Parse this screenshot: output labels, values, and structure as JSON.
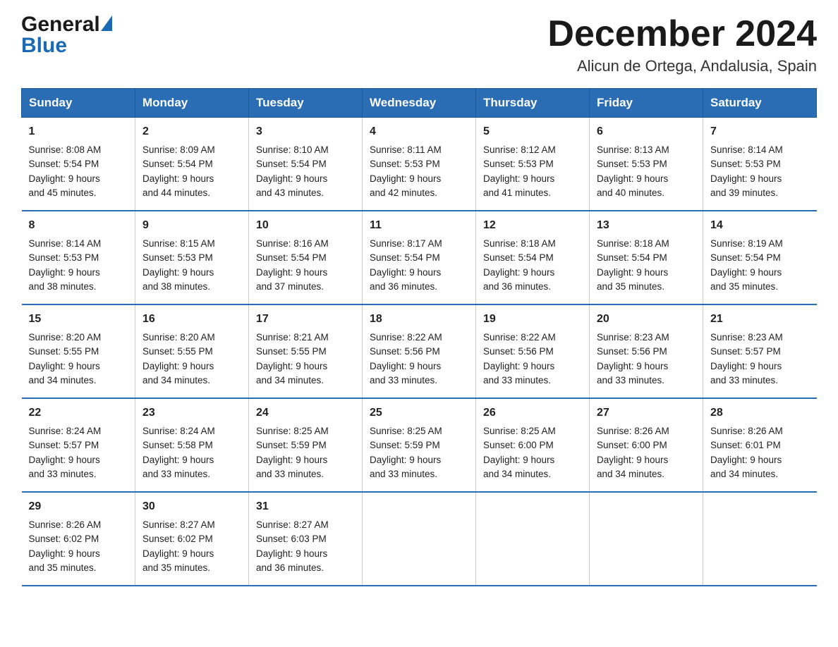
{
  "header": {
    "logo_general": "General",
    "logo_blue": "Blue",
    "title": "December 2024",
    "subtitle": "Alicun de Ortega, Andalusia, Spain"
  },
  "days_of_week": [
    "Sunday",
    "Monday",
    "Tuesday",
    "Wednesday",
    "Thursday",
    "Friday",
    "Saturday"
  ],
  "weeks": [
    {
      "cells": [
        {
          "day": "1",
          "sunrise": "Sunrise: 8:08 AM",
          "sunset": "Sunset: 5:54 PM",
          "daylight": "Daylight: 9 hours",
          "daylight2": "and 45 minutes."
        },
        {
          "day": "2",
          "sunrise": "Sunrise: 8:09 AM",
          "sunset": "Sunset: 5:54 PM",
          "daylight": "Daylight: 9 hours",
          "daylight2": "and 44 minutes."
        },
        {
          "day": "3",
          "sunrise": "Sunrise: 8:10 AM",
          "sunset": "Sunset: 5:54 PM",
          "daylight": "Daylight: 9 hours",
          "daylight2": "and 43 minutes."
        },
        {
          "day": "4",
          "sunrise": "Sunrise: 8:11 AM",
          "sunset": "Sunset: 5:53 PM",
          "daylight": "Daylight: 9 hours",
          "daylight2": "and 42 minutes."
        },
        {
          "day": "5",
          "sunrise": "Sunrise: 8:12 AM",
          "sunset": "Sunset: 5:53 PM",
          "daylight": "Daylight: 9 hours",
          "daylight2": "and 41 minutes."
        },
        {
          "day": "6",
          "sunrise": "Sunrise: 8:13 AM",
          "sunset": "Sunset: 5:53 PM",
          "daylight": "Daylight: 9 hours",
          "daylight2": "and 40 minutes."
        },
        {
          "day": "7",
          "sunrise": "Sunrise: 8:14 AM",
          "sunset": "Sunset: 5:53 PM",
          "daylight": "Daylight: 9 hours",
          "daylight2": "and 39 minutes."
        }
      ]
    },
    {
      "cells": [
        {
          "day": "8",
          "sunrise": "Sunrise: 8:14 AM",
          "sunset": "Sunset: 5:53 PM",
          "daylight": "Daylight: 9 hours",
          "daylight2": "and 38 minutes."
        },
        {
          "day": "9",
          "sunrise": "Sunrise: 8:15 AM",
          "sunset": "Sunset: 5:53 PM",
          "daylight": "Daylight: 9 hours",
          "daylight2": "and 38 minutes."
        },
        {
          "day": "10",
          "sunrise": "Sunrise: 8:16 AM",
          "sunset": "Sunset: 5:54 PM",
          "daylight": "Daylight: 9 hours",
          "daylight2": "and 37 minutes."
        },
        {
          "day": "11",
          "sunrise": "Sunrise: 8:17 AM",
          "sunset": "Sunset: 5:54 PM",
          "daylight": "Daylight: 9 hours",
          "daylight2": "and 36 minutes."
        },
        {
          "day": "12",
          "sunrise": "Sunrise: 8:18 AM",
          "sunset": "Sunset: 5:54 PM",
          "daylight": "Daylight: 9 hours",
          "daylight2": "and 36 minutes."
        },
        {
          "day": "13",
          "sunrise": "Sunrise: 8:18 AM",
          "sunset": "Sunset: 5:54 PM",
          "daylight": "Daylight: 9 hours",
          "daylight2": "and 35 minutes."
        },
        {
          "day": "14",
          "sunrise": "Sunrise: 8:19 AM",
          "sunset": "Sunset: 5:54 PM",
          "daylight": "Daylight: 9 hours",
          "daylight2": "and 35 minutes."
        }
      ]
    },
    {
      "cells": [
        {
          "day": "15",
          "sunrise": "Sunrise: 8:20 AM",
          "sunset": "Sunset: 5:55 PM",
          "daylight": "Daylight: 9 hours",
          "daylight2": "and 34 minutes."
        },
        {
          "day": "16",
          "sunrise": "Sunrise: 8:20 AM",
          "sunset": "Sunset: 5:55 PM",
          "daylight": "Daylight: 9 hours",
          "daylight2": "and 34 minutes."
        },
        {
          "day": "17",
          "sunrise": "Sunrise: 8:21 AM",
          "sunset": "Sunset: 5:55 PM",
          "daylight": "Daylight: 9 hours",
          "daylight2": "and 34 minutes."
        },
        {
          "day": "18",
          "sunrise": "Sunrise: 8:22 AM",
          "sunset": "Sunset: 5:56 PM",
          "daylight": "Daylight: 9 hours",
          "daylight2": "and 33 minutes."
        },
        {
          "day": "19",
          "sunrise": "Sunrise: 8:22 AM",
          "sunset": "Sunset: 5:56 PM",
          "daylight": "Daylight: 9 hours",
          "daylight2": "and 33 minutes."
        },
        {
          "day": "20",
          "sunrise": "Sunrise: 8:23 AM",
          "sunset": "Sunset: 5:56 PM",
          "daylight": "Daylight: 9 hours",
          "daylight2": "and 33 minutes."
        },
        {
          "day": "21",
          "sunrise": "Sunrise: 8:23 AM",
          "sunset": "Sunset: 5:57 PM",
          "daylight": "Daylight: 9 hours",
          "daylight2": "and 33 minutes."
        }
      ]
    },
    {
      "cells": [
        {
          "day": "22",
          "sunrise": "Sunrise: 8:24 AM",
          "sunset": "Sunset: 5:57 PM",
          "daylight": "Daylight: 9 hours",
          "daylight2": "and 33 minutes."
        },
        {
          "day": "23",
          "sunrise": "Sunrise: 8:24 AM",
          "sunset": "Sunset: 5:58 PM",
          "daylight": "Daylight: 9 hours",
          "daylight2": "and 33 minutes."
        },
        {
          "day": "24",
          "sunrise": "Sunrise: 8:25 AM",
          "sunset": "Sunset: 5:59 PM",
          "daylight": "Daylight: 9 hours",
          "daylight2": "and 33 minutes."
        },
        {
          "day": "25",
          "sunrise": "Sunrise: 8:25 AM",
          "sunset": "Sunset: 5:59 PM",
          "daylight": "Daylight: 9 hours",
          "daylight2": "and 33 minutes."
        },
        {
          "day": "26",
          "sunrise": "Sunrise: 8:25 AM",
          "sunset": "Sunset: 6:00 PM",
          "daylight": "Daylight: 9 hours",
          "daylight2": "and 34 minutes."
        },
        {
          "day": "27",
          "sunrise": "Sunrise: 8:26 AM",
          "sunset": "Sunset: 6:00 PM",
          "daylight": "Daylight: 9 hours",
          "daylight2": "and 34 minutes."
        },
        {
          "day": "28",
          "sunrise": "Sunrise: 8:26 AM",
          "sunset": "Sunset: 6:01 PM",
          "daylight": "Daylight: 9 hours",
          "daylight2": "and 34 minutes."
        }
      ]
    },
    {
      "cells": [
        {
          "day": "29",
          "sunrise": "Sunrise: 8:26 AM",
          "sunset": "Sunset: 6:02 PM",
          "daylight": "Daylight: 9 hours",
          "daylight2": "and 35 minutes."
        },
        {
          "day": "30",
          "sunrise": "Sunrise: 8:27 AM",
          "sunset": "Sunset: 6:02 PM",
          "daylight": "Daylight: 9 hours",
          "daylight2": "and 35 minutes."
        },
        {
          "day": "31",
          "sunrise": "Sunrise: 8:27 AM",
          "sunset": "Sunset: 6:03 PM",
          "daylight": "Daylight: 9 hours",
          "daylight2": "and 36 minutes."
        },
        {
          "day": "",
          "sunrise": "",
          "sunset": "",
          "daylight": "",
          "daylight2": ""
        },
        {
          "day": "",
          "sunrise": "",
          "sunset": "",
          "daylight": "",
          "daylight2": ""
        },
        {
          "day": "",
          "sunrise": "",
          "sunset": "",
          "daylight": "",
          "daylight2": ""
        },
        {
          "day": "",
          "sunrise": "",
          "sunset": "",
          "daylight": "",
          "daylight2": ""
        }
      ]
    }
  ]
}
